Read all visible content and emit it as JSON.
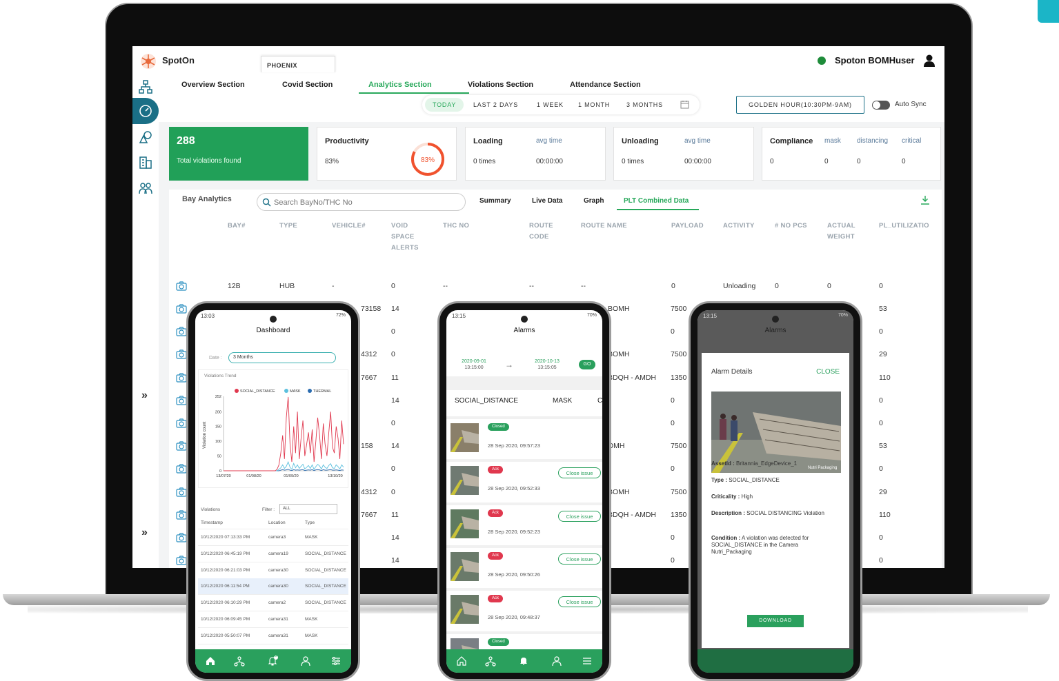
{
  "app": {
    "brand": "SpotOn",
    "tenant_tab": "PHOENIX",
    "username": "Spoton BOMHuser",
    "colors": {
      "accent": "#27a85a",
      "primary": "#1a6f86",
      "alert": "#e0384e",
      "gauge": "#f0522e"
    }
  },
  "nav": {
    "tabs": [
      "Overview Section",
      "Covid Section",
      "Analytics Section",
      "Violations Section",
      "Attendance Section"
    ],
    "active": "Analytics Section"
  },
  "ranges": {
    "items": [
      "TODAY",
      "LAST 2 DAYS",
      "1 WEEK",
      "1 MONTH",
      "3 MONTHS"
    ],
    "active": "TODAY",
    "calendar_icon": "calendar-icon"
  },
  "golden_hour": "GOLDEN HOUR(10:30PM-9AM)",
  "auto_sync": "Auto Sync",
  "cards": {
    "violations": {
      "count": "288",
      "label": "Total violations found"
    },
    "productivity": {
      "title": "Productivity",
      "value": "83%",
      "gauge_label": "83%",
      "gauge_fraction": 0.83
    },
    "loading": {
      "title": "Loading",
      "sub": "avg time",
      "value": "0 times",
      "time": "00:00:00"
    },
    "unloading": {
      "title": "Unloading",
      "sub": "avg time",
      "value": "0 times",
      "time": "00:00:00"
    },
    "compliance": {
      "title": "Compliance",
      "subs": [
        "mask",
        "distancing",
        "critical"
      ],
      "values": [
        "0",
        "0",
        "0",
        "0"
      ]
    }
  },
  "bay": {
    "title": "Bay Analytics",
    "search_placeholder": "Search BayNo/THC No",
    "tabs": [
      "Summary",
      "Live Data",
      "Graph",
      "PLT Combined Data"
    ],
    "active_tab": "PLT Combined Data",
    "columns": [
      "BAY#",
      "TYPE",
      "VEHICLE#",
      "VOID\nSPACE\nALERTS",
      "THC NO",
      "ROUTE\nCODE",
      "ROUTE NAME",
      "PAYLOAD",
      "ACTIVITY",
      "# NO PCS",
      "ACTUAL\nWEIGHT",
      "PL_UTILIZATIO"
    ],
    "first_row": [
      "12B",
      "HUB",
      "-",
      "0",
      "--",
      "--",
      "--",
      "0",
      "Unloading",
      "0",
      "0",
      "0"
    ],
    "rows": [
      {
        "vehicle": "73158",
        "void": "14",
        "route": "BOMH",
        "payload": "7500",
        "util": "53"
      },
      {
        "vehicle": "",
        "void": "0",
        "route": "",
        "payload": "0",
        "util": "0"
      },
      {
        "vehicle": "4312",
        "void": "0",
        "route": "BOMH",
        "payload": "7500",
        "util": "29"
      },
      {
        "vehicle": "7667",
        "void": "11",
        "route": "BDQH - AMDH",
        "payload": "1350",
        "util": "110"
      },
      {
        "vehicle": "",
        "void": "14",
        "route": "",
        "payload": "0",
        "util": "0"
      },
      {
        "vehicle": "",
        "void": "0",
        "route": "",
        "payload": "0",
        "util": "0"
      },
      {
        "vehicle": "158",
        "void": "14",
        "route": "OMH",
        "payload": "7500",
        "util": "53"
      },
      {
        "vehicle": "",
        "void": "0",
        "route": "",
        "payload": "0",
        "util": "0"
      },
      {
        "vehicle": "4312",
        "void": "0",
        "route": "BOMH",
        "payload": "7500",
        "util": "29"
      },
      {
        "vehicle": "7667",
        "void": "11",
        "route": "BDQH - AMDH",
        "payload": "1350",
        "util": "110"
      },
      {
        "vehicle": "",
        "void": "14",
        "route": "",
        "payload": "0",
        "util": "0"
      },
      {
        "vehicle": "",
        "void": "14",
        "route": "",
        "payload": "0",
        "util": "0"
      }
    ]
  },
  "phone1": {
    "time": "13:03",
    "battery": "72%",
    "title": "Dashboard",
    "date_label": "Date :",
    "date_value": "3 Months",
    "chart_title": "Violations Trend",
    "violations_title": "Violations",
    "filter_label": "Filter :",
    "filter_value": "ALL",
    "list_headers": [
      "Timestamp",
      "Location",
      "Type"
    ],
    "list": [
      [
        "10/12/2020 07:13:33 PM",
        "camera3",
        "MASK"
      ],
      [
        "10/12/2020 06:45:19 PM",
        "camera19",
        "SOCIAL_DISTANCE"
      ],
      [
        "10/12/2020 06:21:03 PM",
        "camera30",
        "SOCIAL_DISTANCE"
      ],
      [
        "10/12/2020 06:11:54 PM",
        "camera30",
        "SOCIAL_DISTANCE"
      ],
      [
        "10/12/2020 06:10:29 PM",
        "camera2",
        "SOCIAL_DISTANCE"
      ],
      [
        "10/12/2020 06:09:45 PM",
        "camera31",
        "MASK"
      ],
      [
        "10/12/2020 05:50:07 PM",
        "camera31",
        "MASK"
      ]
    ],
    "notif_count": "0"
  },
  "chart_data": {
    "type": "line",
    "title": "Violations Trend",
    "ylabel": "Violation count",
    "ylim": [
      0,
      252
    ],
    "yticks": [
      "252",
      "200",
      "150",
      "100",
      "50",
      "0"
    ],
    "xticks": [
      "13/07/20",
      "01/08/20",
      "01/09/20",
      "13/10/20"
    ],
    "series": [
      {
        "name": "SOCIAL_DISTANCE",
        "color": "#e0384e",
        "values": [
          0,
          0,
          0,
          0,
          0,
          0,
          0,
          0,
          0,
          0,
          0,
          0,
          0,
          0,
          0,
          0,
          0,
          0,
          0,
          0,
          0,
          0,
          0,
          0,
          0,
          0,
          0,
          0,
          0,
          5,
          20,
          60,
          120,
          40,
          180,
          250,
          90,
          30,
          150,
          60,
          200,
          40,
          110,
          170,
          50,
          90,
          130,
          60,
          140,
          30,
          100,
          180,
          120,
          40,
          160,
          90,
          50,
          130,
          200,
          80,
          60,
          150,
          110,
          40,
          170,
          90
        ]
      },
      {
        "name": "MASK",
        "color": "#5bc0de",
        "values": [
          0,
          0,
          0,
          0,
          0,
          0,
          0,
          0,
          0,
          0,
          0,
          0,
          0,
          0,
          0,
          0,
          0,
          0,
          0,
          0,
          0,
          0,
          0,
          0,
          0,
          0,
          0,
          0,
          0,
          0,
          5,
          10,
          20,
          8,
          15,
          30,
          12,
          5,
          25,
          10,
          20,
          8,
          15,
          22,
          6,
          12,
          18,
          8,
          20,
          5,
          14,
          22,
          16,
          6,
          20,
          12,
          8,
          18,
          24,
          10,
          8,
          20,
          14,
          6,
          20,
          12
        ]
      },
      {
        "name": "THERMAL",
        "color": "#2b6cb0",
        "values": [
          0,
          0,
          0,
          0,
          0,
          0,
          0,
          0,
          0,
          0,
          0,
          0,
          0,
          0,
          0,
          0,
          0,
          0,
          0,
          0,
          0,
          0,
          0,
          0,
          0,
          0,
          0,
          0,
          0,
          0,
          0,
          2,
          4,
          2,
          3,
          5,
          2,
          1,
          4,
          2,
          3,
          2,
          3,
          4,
          1,
          2,
          3,
          2,
          4,
          1,
          3,
          4,
          3,
          1,
          4,
          2,
          2,
          3,
          4,
          2,
          2,
          3,
          2,
          1,
          3,
          2
        ]
      }
    ]
  },
  "phone2": {
    "time": "13:15",
    "battery": "70%",
    "title": "Alarms",
    "from_date": "2020-09-01",
    "from_time": "13:15:00",
    "to_date": "2020-10-13",
    "to_time": "13:15:05",
    "go": "GO",
    "tabs": [
      "SOCIAL_DISTANCE",
      "MASK",
      "C"
    ],
    "close_issue": "Close issue",
    "alarms": [
      {
        "status": "Closed",
        "time": "28 Sep 2020, 09:57:23"
      },
      {
        "status": "Ack",
        "time": "28 Sep 2020, 09:52:33"
      },
      {
        "status": "Ack",
        "time": "28 Sep 2020, 09:52:23"
      },
      {
        "status": "Ack",
        "time": "28 Sep 2020, 09:50:26"
      },
      {
        "status": "Ack",
        "time": "28 Sep 2020, 09:48:37"
      },
      {
        "status": "Closed",
        "time": ""
      }
    ]
  },
  "phone3": {
    "time": "13:15",
    "battery": "70%",
    "title": "Alarms",
    "card_title": "Alarm Details",
    "close": "CLOSE",
    "image_caption": "Nutri Packaging",
    "fields": [
      {
        "label": "AssetId :",
        "value": "Britannia_EdgeDevice_1"
      },
      {
        "label": "Type :",
        "value": "SOCIAL_DISTANCE"
      },
      {
        "label": "Criticality :",
        "value": "High"
      },
      {
        "label": "Description :",
        "value": "SOCIAL DISTANCING Violation"
      },
      {
        "label": "Condition :",
        "value": "A violation was detected for SOCIAL_DISTANCE in the Camera Nutri_Packaging"
      }
    ],
    "download": "DOWNLOAD"
  }
}
